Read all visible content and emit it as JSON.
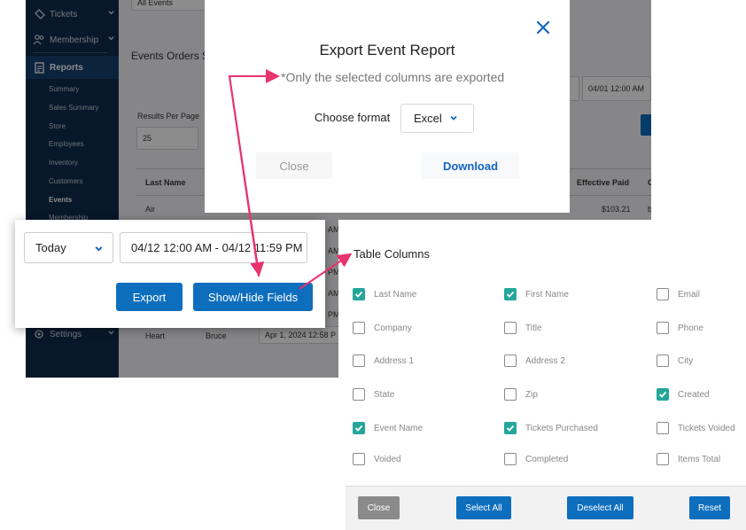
{
  "sidebar": {
    "items": [
      {
        "label": "Tickets",
        "icon": "ticket-icon"
      },
      {
        "label": "Membership",
        "icon": "people-icon"
      },
      {
        "label": "Reports",
        "icon": "report-icon"
      },
      {
        "label": "Settings",
        "icon": "gear-icon"
      }
    ],
    "sub_items": [
      "Summary",
      "Sales Summary",
      "Store",
      "Employees",
      "Inventory",
      "Customers",
      "Events",
      "Membership"
    ]
  },
  "main": {
    "event_filter": "All Events",
    "page_title": "Events Orders S",
    "results_label": "Results Per Page",
    "results_value": "25",
    "date_fragment": "04/01 12:00 AM",
    "col_last_name": "Last Name",
    "col_effective_paid": "Effective Paid",
    "col_c": "C",
    "row1_last": "Air",
    "row1_paid": "$103.21",
    "row1_extra": "b",
    "row_last": "Heart",
    "row_first": "Bruce",
    "row_date": "Apr 1, 2024 12:58 P",
    "row_am": [
      "AM",
      "AM",
      "PM",
      "AM",
      "PM",
      "PM"
    ]
  },
  "export_modal": {
    "title": "Export Event Report",
    "note": "*Only the selected columns are exported",
    "format_label": "Choose format",
    "format_value": "Excel",
    "close_label": "Close",
    "download_label": "Download"
  },
  "date_panel": {
    "range_value": "Today",
    "date_value": "04/12 12:00 AM - 04/12 11:59 PM",
    "export_label": "Export",
    "showhide_label": "Show/Hide Fields"
  },
  "columns_panel": {
    "title": "Table Columns",
    "columns": [
      {
        "label": "Last Name",
        "checked": true
      },
      {
        "label": "First Name",
        "checked": true
      },
      {
        "label": "Email",
        "checked": false
      },
      {
        "label": "Company",
        "checked": false
      },
      {
        "label": "Title",
        "checked": false
      },
      {
        "label": "Phone",
        "checked": false
      },
      {
        "label": "Address 1",
        "checked": false
      },
      {
        "label": "Address 2",
        "checked": false
      },
      {
        "label": "City",
        "checked": false
      },
      {
        "label": "State",
        "checked": false
      },
      {
        "label": "Zip",
        "checked": false
      },
      {
        "label": "Created",
        "checked": true
      },
      {
        "label": "Event Name",
        "checked": true
      },
      {
        "label": "Tickets Purchased",
        "checked": true
      },
      {
        "label": "Tickets Voided",
        "checked": false
      },
      {
        "label": "Voided",
        "checked": false
      },
      {
        "label": "Completed",
        "checked": false
      },
      {
        "label": "Items Total",
        "checked": false
      }
    ],
    "close_label": "Close",
    "select_all_label": "Select All",
    "deselect_all_label": "Deselect All",
    "reset_label": "Reset"
  },
  "colors": {
    "sidebar": "#0f2b4d",
    "primary": "#0e6ebe",
    "check": "#26a69a",
    "annotation": "#e8336d"
  }
}
